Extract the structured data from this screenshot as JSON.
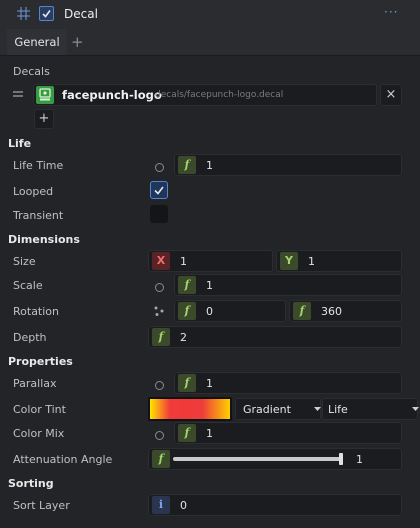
{
  "header": {
    "title": "Decal",
    "more": "···",
    "grid_icon": "grid-icon",
    "enabled": true
  },
  "tabs": {
    "general": "General",
    "add": "+"
  },
  "decals": {
    "section_label": "Decals",
    "item_name": "facepunch-logo",
    "item_path": "decals/facepunch-logo.decal",
    "add_label": "+",
    "remove_label": "×"
  },
  "life": {
    "section_label": "Life",
    "life_time_label": "Life Time",
    "life_time_badge": "f",
    "life_time_value": "1",
    "looped_label": "Looped",
    "looped": true,
    "transient_label": "Transient",
    "transient": false
  },
  "dimensions": {
    "section_label": "Dimensions",
    "size_label": "Size",
    "size_x_badge": "X",
    "size_x": "1",
    "size_y_badge": "Y",
    "size_y": "1",
    "scale_label": "Scale",
    "scale_badge": "f",
    "scale_value": "1",
    "rotation_label": "Rotation",
    "rotation_min_badge": "f",
    "rotation_min": "0",
    "rotation_max_badge": "f",
    "rotation_max": "360",
    "depth_label": "Depth",
    "depth_badge": "f",
    "depth_value": "2"
  },
  "properties": {
    "section_label": "Properties",
    "parallax_label": "Parallax",
    "parallax_badge": "f",
    "parallax_value": "1",
    "color_tint_label": "Color Tint",
    "color_tint_mode": "Gradient",
    "color_tint_over": "Life",
    "color_mix_label": "Color Mix",
    "color_mix_badge": "f",
    "color_mix_value": "1",
    "attenuation_label": "Attenuation Angle",
    "attenuation_badge": "f",
    "attenuation_value": "1",
    "attenuation_fraction": 1.0
  },
  "sorting": {
    "section_label": "Sorting",
    "sort_layer_label": "Sort Layer",
    "sort_layer_badge": "i",
    "sort_layer_value": "0"
  },
  "colors": {
    "background": "#232427",
    "accent": "#4f86d9",
    "float_badge": "#a3d36b",
    "x_badge": "#f07070",
    "gradient_start": "#ffe400",
    "gradient_mid": "#ee3b3b",
    "gradient_end": "#ffd000"
  }
}
